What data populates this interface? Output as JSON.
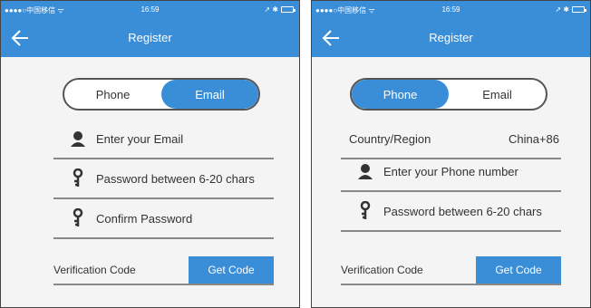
{
  "status_bar": {
    "carrier": "●●●●○中国移信 ᯤ",
    "time": "16:59",
    "indicators": "↗ ✱"
  },
  "screen_email": {
    "title": "Register",
    "toggle": {
      "phone_label": "Phone",
      "email_label": "Email",
      "active": "Email"
    },
    "email_placeholder": "Enter your Email",
    "password_placeholder": "Password between 6-20 chars",
    "confirm_placeholder": "Confirm Password",
    "verification_label": "Verification Code",
    "get_code_label": "Get Code"
  },
  "screen_phone": {
    "title": "Register",
    "toggle": {
      "phone_label": "Phone",
      "email_label": "Email",
      "active": "Phone"
    },
    "country_label": "Country/Region",
    "country_value": "China+86",
    "phone_placeholder": "Enter your Phone number",
    "password_placeholder": "Password between 6-20 chars",
    "verification_label": "Verification Code",
    "get_code_label": "Get Code"
  },
  "colors": {
    "accent": "#3a8ed8",
    "background": "#f4f4f4",
    "divider": "#888888"
  },
  "icons": [
    "back-arrow-icon",
    "user-icon",
    "key-icon",
    "battery-icon"
  ]
}
